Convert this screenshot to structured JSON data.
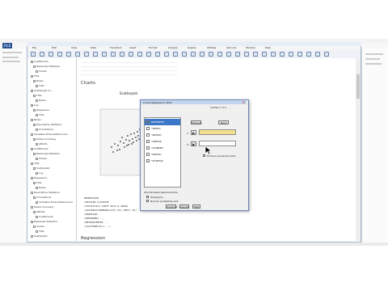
{
  "word": {
    "file_tab": "FILE",
    "tabs": [
      "",
      "",
      "",
      "",
      "",
      "",
      ""
    ]
  },
  "spss": {
    "window_title": "",
    "menu": [
      "File",
      "Edit",
      "View",
      "Data",
      "Transform",
      "Insert",
      "Format",
      "Analyze",
      "Graphs",
      "Utilities",
      "Add-ons",
      "Window",
      "Help"
    ],
    "outline": [
      "Coefficients",
      "Residuals Statistics",
      "Charts",
      "Title",
      "Notes",
      "Title",
      "Scatterplot of ...",
      "Title",
      "Notes",
      "Log",
      "Regression",
      "Title",
      "Notes",
      "Descriptive Statistics",
      "Correlations",
      "Variables Entered/Removed",
      "Model Summary",
      "ANOVA",
      "Coefficients",
      "Residuals Statistics",
      "Charts",
      "Title",
      "Scatterplot",
      "Log",
      "Regression",
      "Title",
      "Notes",
      "Descriptive Statistics",
      "Correlations",
      "Variables Entered/Removed",
      "Model Summary",
      "ANOVA",
      "Coefficients",
      "Residuals Statistics",
      "Charts",
      "Title",
      "Scatterplot"
    ],
    "output": {
      "charts_heading": "Charts",
      "regression_heading": "Regression",
      "scatter_title": "Scatterplot",
      "syntax_lines": [
        "REGRESSION",
        "/MISSING LISTWISE",
        "/STATISTICS COEFF OUTS R ANOVA",
        "/CRITERIA=PROBABILITY(.05) POUT(.10)",
        "/NOORIGIN",
        "/DEPENDENT ...",
        "/METHOD=ENTER ...",
        "/SCATTERPLOT=(...)."
      ]
    }
  },
  "dialog": {
    "title": "Linear Regression: Plots",
    "variables": [
      "DEPENDNT",
      "*ZPRED",
      "*ZRESID",
      "*DRESID",
      "*ADJPRED",
      "*SRESID",
      "*SDRESID"
    ],
    "scatter_label": "Scatter 1 of 1",
    "prev_label": "Previous",
    "next_label": "Next",
    "y_label": "Y:",
    "x_label": "X:",
    "std_resid_group": "Standardized Residual Plots",
    "histogram_label": "Histogram",
    "normal_plot_label": "Normal probability plot",
    "partial_plots_label": "Produce all partial plots",
    "buttons": [
      "Continue",
      "Cancel",
      "Help"
    ]
  },
  "colors": {
    "accent": "#2b5797",
    "dialog_title": "#c4d6ee",
    "highlight_field": "#f4e08a"
  }
}
